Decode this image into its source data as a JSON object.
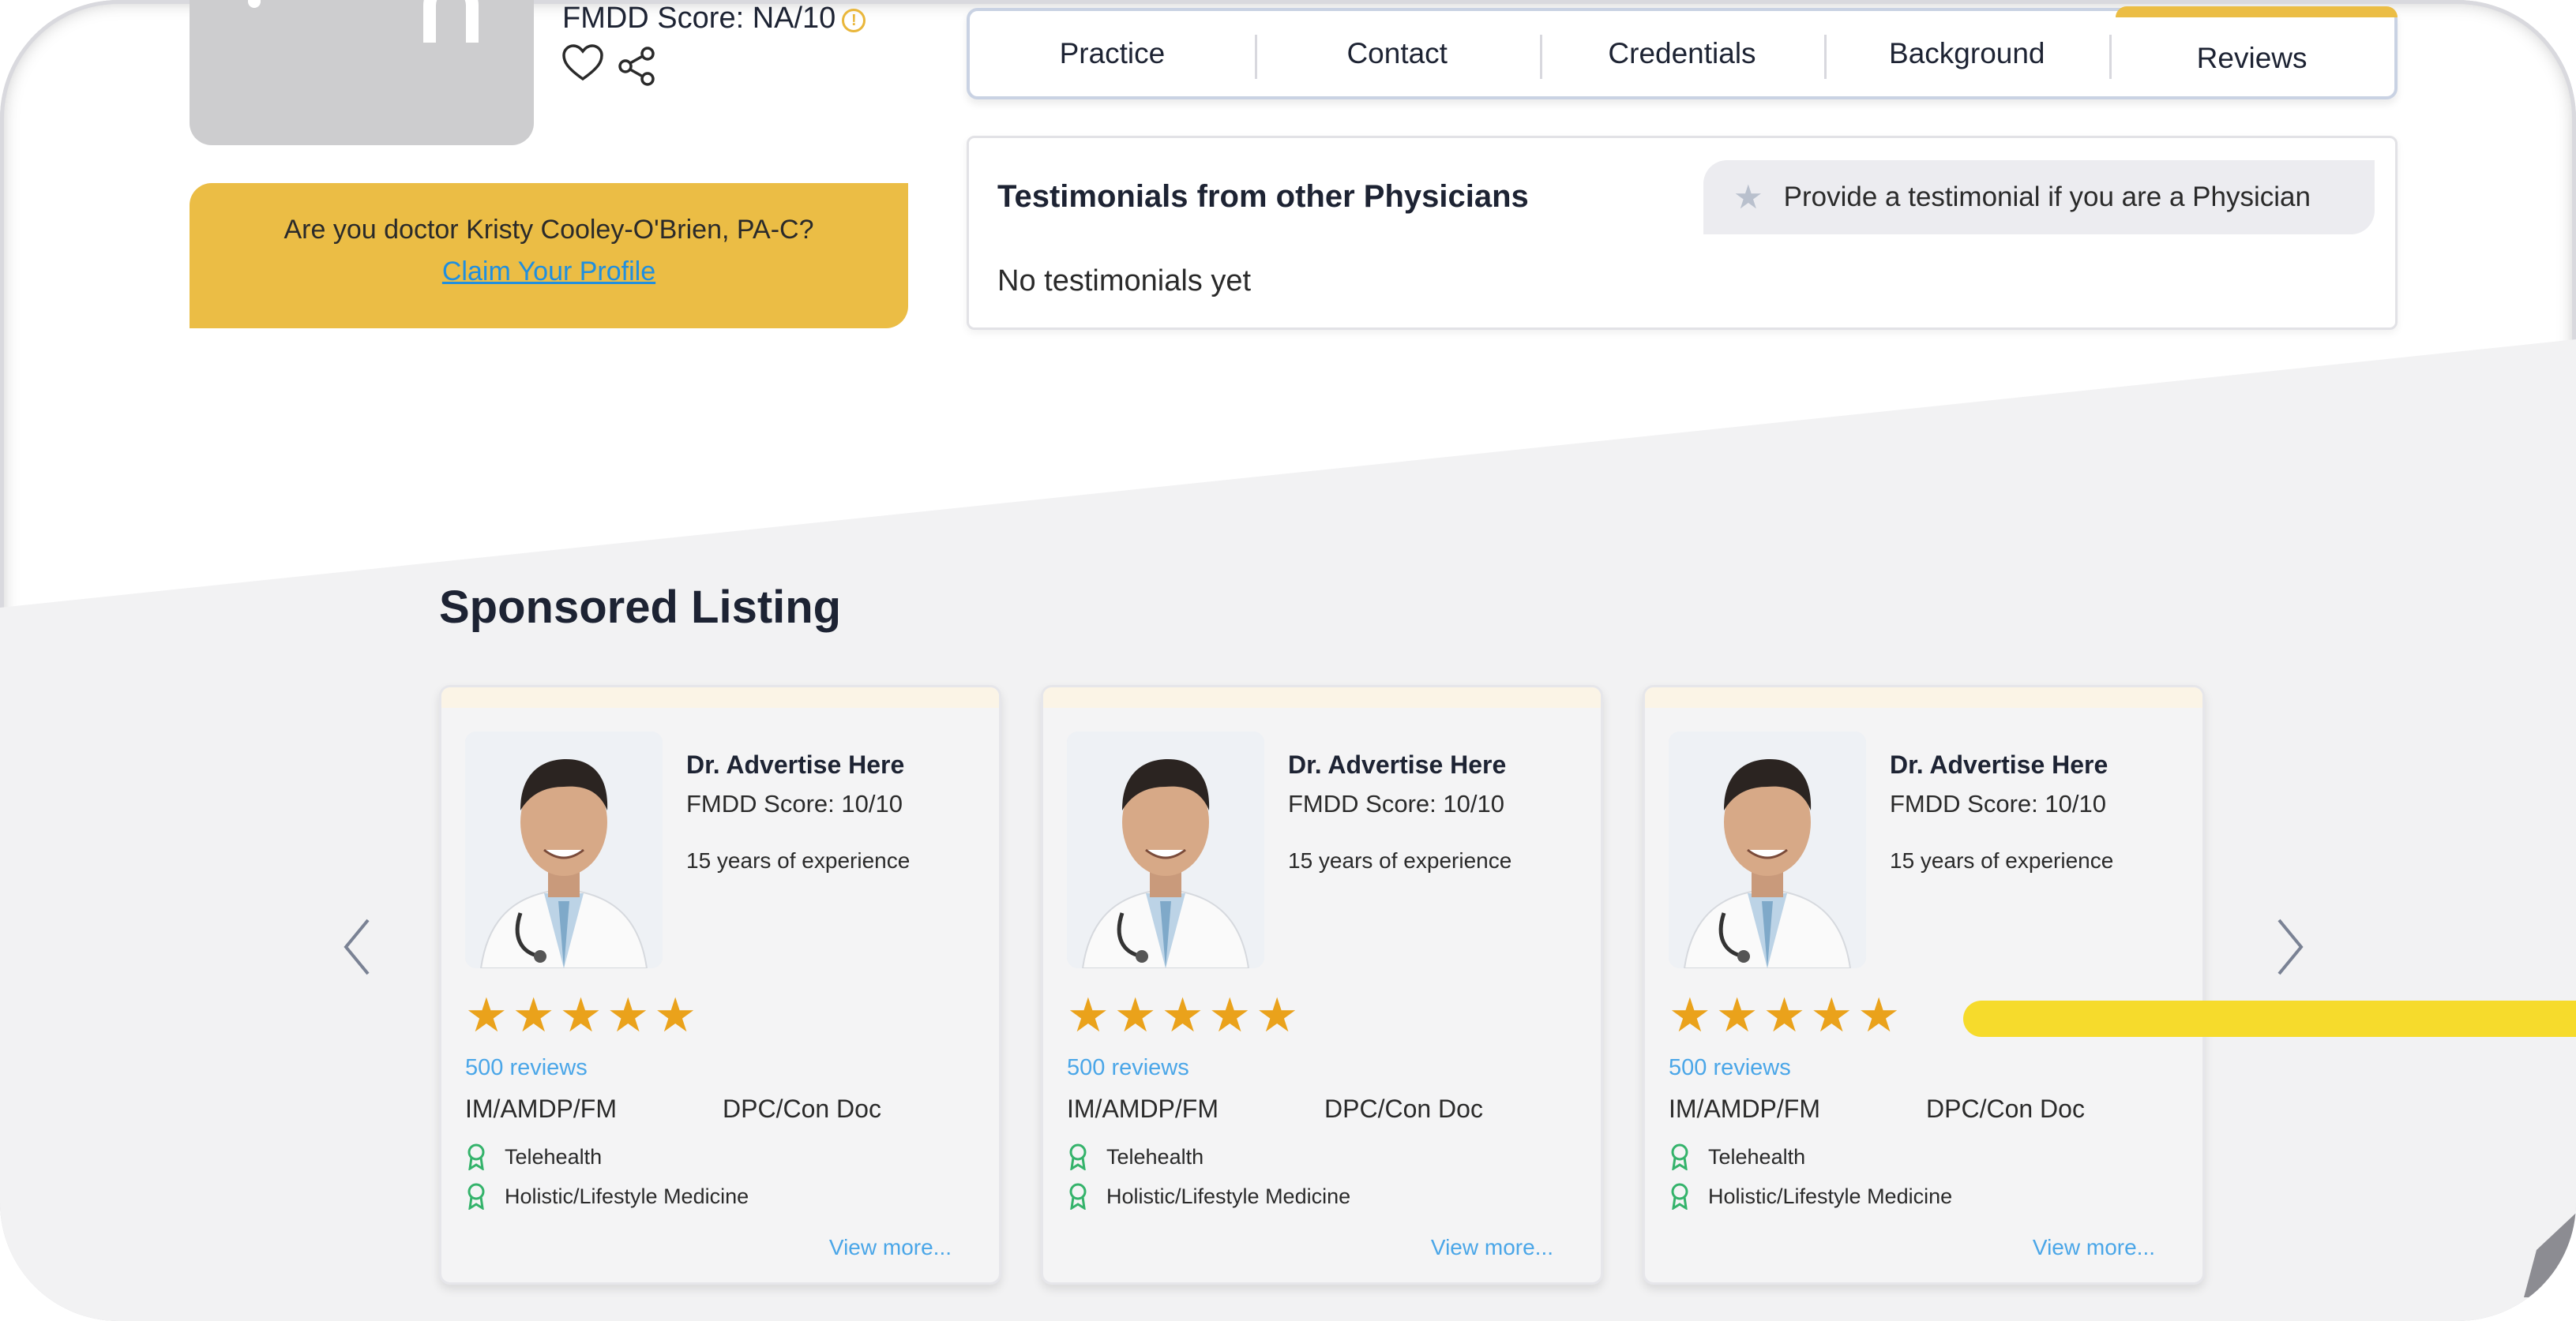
{
  "profile": {
    "score_text": "FMDD Score: NA/10",
    "info_icon": "info-circle-icon",
    "heart_icon": "heart-icon",
    "share_icon": "share-icon"
  },
  "claim": {
    "question": "Are you doctor Kristy Cooley-O'Brien, PA-C?",
    "link": "Claim Your Profile"
  },
  "tabs": [
    {
      "label": "Practice"
    },
    {
      "label": "Contact"
    },
    {
      "label": "Credentials"
    },
    {
      "label": "Background"
    },
    {
      "label": "Reviews",
      "active": true
    }
  ],
  "testimonials": {
    "title": "Testimonials from other Physicians",
    "empty": "No testimonials yet",
    "provide_button": "Provide a testimonial if you are a Physician"
  },
  "sponsored": {
    "title": "Sponsored Listing",
    "cards": [
      {
        "name": "Dr. Advertise Here",
        "score": "FMDD Score: 10/10",
        "experience": "15 years of experience",
        "rating": 5,
        "reviews": "500 reviews",
        "spec1": "IM/AMDP/FM",
        "spec2": "DPC/Con Doc",
        "feature1": "Telehealth",
        "feature2": "Holistic/Lifestyle Medicine",
        "view_more": "View more..."
      },
      {
        "name": "Dr. Advertise Here",
        "score": "FMDD Score: 10/10",
        "experience": "15 years of experience",
        "rating": 5,
        "reviews": "500 reviews",
        "spec1": "IM/AMDP/FM",
        "spec2": "DPC/Con Doc",
        "feature1": "Telehealth",
        "feature2": "Holistic/Lifestyle Medicine",
        "view_more": "View more..."
      },
      {
        "name": "Dr. Advertise Here",
        "score": "FMDD Score: 10/10",
        "experience": "15 years of experience",
        "rating": 5,
        "reviews": "500 reviews",
        "spec1": "IM/AMDP/FM",
        "spec2": "DPC/Con Doc",
        "feature1": "Telehealth",
        "feature2": "Holistic/Lifestyle Medicine",
        "view_more": "View more..."
      }
    ]
  },
  "colors": {
    "accent_yellow": "#ebbd45",
    "star_orange": "#eaa21b",
    "link_blue": "#4aa6e8",
    "highlight_bar": "#f6db2c"
  }
}
